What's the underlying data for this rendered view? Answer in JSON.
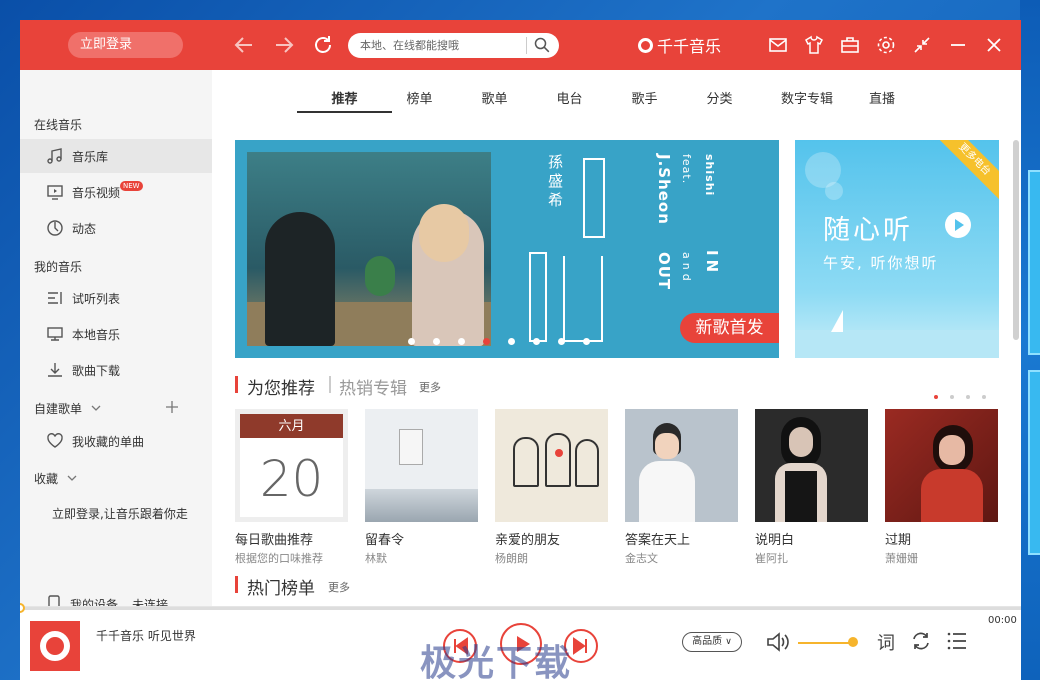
{
  "titlebar": {
    "login_label": "立即登录",
    "search_placeholder": "本地、在线都能搜哦",
    "brand_name": "千千音乐"
  },
  "sidebar": {
    "online_heading": "在线音乐",
    "online_items": [
      {
        "label": "音乐库",
        "icon": "music-note-icon"
      },
      {
        "label": "音乐视频",
        "icon": "tv-icon",
        "badge": "NEW"
      },
      {
        "label": "动态",
        "icon": "dynamic-icon"
      }
    ],
    "my_heading": "我的音乐",
    "my_items": [
      {
        "label": "试听列表",
        "icon": "playlist-icon"
      },
      {
        "label": "本地音乐",
        "icon": "monitor-icon"
      },
      {
        "label": "歌曲下载",
        "icon": "download-icon"
      }
    ],
    "custom_heading": "自建歌单",
    "custom_items": [
      {
        "label": "我收藏的单曲",
        "icon": "heart-icon"
      }
    ],
    "favorites_heading": "收藏",
    "favorites_hint": "立即登录,让音乐跟着你走",
    "device_label": "我的设备",
    "device_status": "未连接"
  },
  "tabs": [
    "推荐",
    "榜单",
    "歌单",
    "电台",
    "歌手",
    "分类",
    "数字专辑",
    "直播"
  ],
  "active_tab": "推荐",
  "banner": {
    "artist_cn": "孫盛希",
    "artist_en": "J.Sheon",
    "feat": "feat.",
    "feat_artist": "shishi",
    "track_en_1": "IN",
    "track_en_2": "and",
    "track_en_3": "OUT",
    "badge": "新歌首发",
    "slide_count": 8,
    "active_slide": 4
  },
  "side_banner": {
    "ribbon": "更多电台",
    "headline": "随心听",
    "subline": "午安, 听你想听"
  },
  "recommend": {
    "title": "为您推荐",
    "alt_title": "热销专辑",
    "more": "更多",
    "cards": [
      {
        "title": "每日歌曲推荐",
        "subtitle": "根据您的口味推荐",
        "cal_month": "六月",
        "cal_day": "20"
      },
      {
        "title": "留春令",
        "subtitle": "林默"
      },
      {
        "title": "亲爱的朋友",
        "subtitle": "杨朗朗"
      },
      {
        "title": "答案在天上",
        "subtitle": "金志文"
      },
      {
        "title": "说明白",
        "subtitle": "崔阿扎"
      },
      {
        "title": "过期",
        "subtitle": "萧姗姗"
      }
    ]
  },
  "hot": {
    "title": "热门榜单",
    "more": "更多"
  },
  "player": {
    "song": "千千音乐 听见世界",
    "time": "00:00",
    "quality": "高品质",
    "lyrics_label": "词",
    "progress": 0,
    "volume": 0.95
  },
  "watermark": "极光下载",
  "colors": {
    "accent": "#e8433a",
    "sidebar_bg": "#f5f5f5",
    "volume": "#f6b42c"
  }
}
